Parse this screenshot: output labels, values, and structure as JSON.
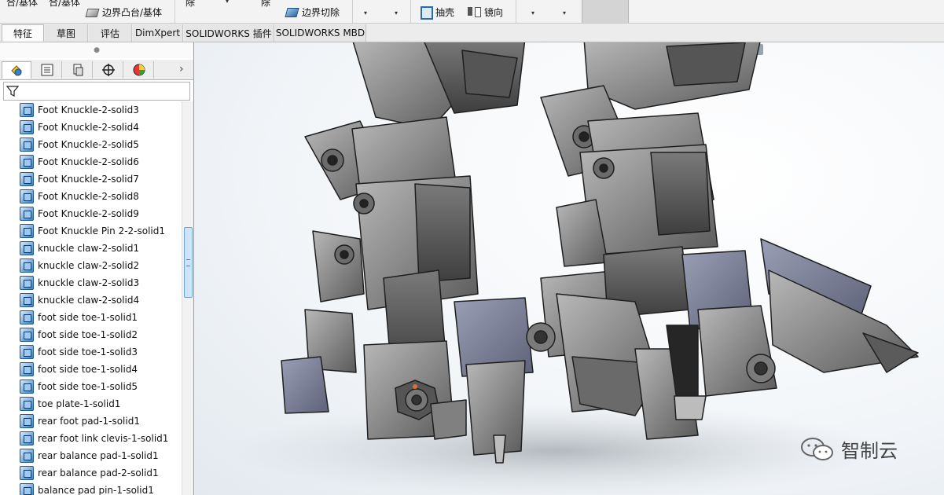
{
  "ribbon": {
    "cut_top_left": "合/基体",
    "cut_top_left2": "合/基体",
    "boundary_boss": "边界凸台/基体",
    "cut_remove1": "除",
    "cut_remove2": "除",
    "boundary_cut": "边界切除",
    "shell": "抽壳",
    "mirror": "镜向"
  },
  "tabs": [
    {
      "label": "特征",
      "active": true
    },
    {
      "label": "草图"
    },
    {
      "label": "评估"
    },
    {
      "label": "DimXpert"
    },
    {
      "label": "SOLIDWORKS 插件"
    },
    {
      "label": "SOLIDWORKS MBD"
    }
  ],
  "panel": {
    "grip": "●",
    "more_arrow": "›"
  },
  "tree_items": [
    "Foot Knuckle-2-solid3",
    "Foot Knuckle-2-solid4",
    "Foot Knuckle-2-solid5",
    "Foot Knuckle-2-solid6",
    "Foot Knuckle-2-solid7",
    "Foot Knuckle-2-solid8",
    "Foot Knuckle-2-solid9",
    "Foot Knuckle Pin 2-2-solid1",
    "knuckle claw-2-solid1",
    "knuckle claw-2-solid2",
    "knuckle claw-2-solid3",
    "knuckle claw-2-solid4",
    "foot side toe-1-solid1",
    "foot side toe-1-solid2",
    "foot side toe-1-solid3",
    "foot side toe-1-solid4",
    "foot side toe-1-solid5",
    "toe plate-1-solid1",
    "rear foot pad-1-solid1",
    "rear foot link clevis-1-solid1",
    "rear balance pad-1-solid1",
    "rear balance pad-2-solid1",
    "balance pad pin-1-solid1"
  ],
  "watermark": {
    "text": "智制云",
    "icon": "wechat-icon"
  },
  "colors": {
    "ribbon_bg": "#f3f3f3",
    "panel_bg": "#ffffff",
    "body_icon": "#3b7fc4",
    "model_gray": "#8c8c8c"
  }
}
